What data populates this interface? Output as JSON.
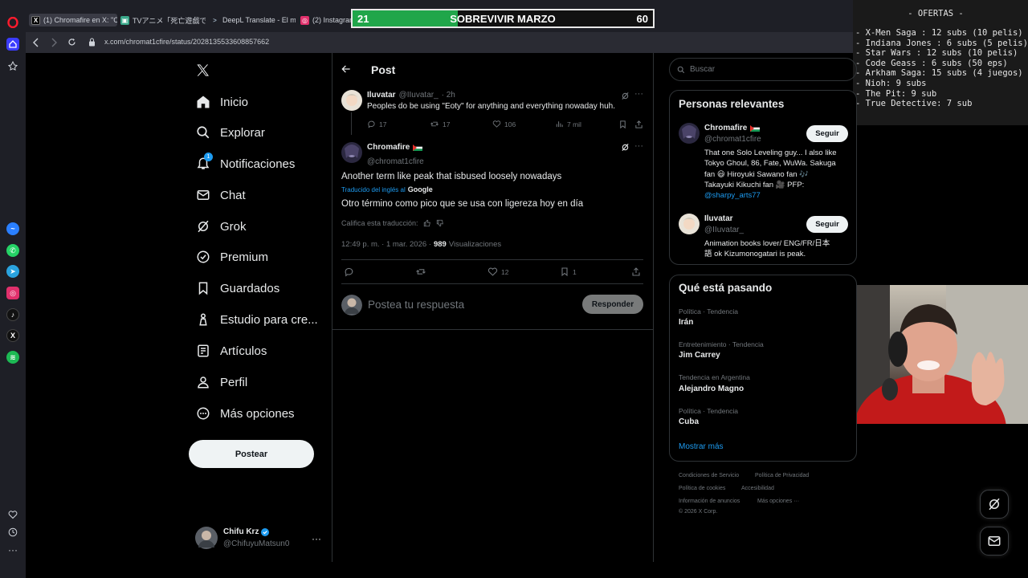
{
  "browser": {
    "tabs": [
      {
        "label": "(1) Chromafire en X: \"C",
        "icon": "x-icon"
      },
      {
        "label": "TVアニメ「死亡遊戯で飯を食",
        "icon": "tv-icon"
      },
      {
        "label": "DeepL Translate - El mejor",
        "icon": "deepl-icon"
      },
      {
        "label": "(2) Instagram",
        "icon": "instagram-icon"
      }
    ],
    "url": "x.com/chromat1cfire/status/2028135533608857662",
    "sidebar_apps": [
      "messenger",
      "whatsapp",
      "telegram",
      "instagram",
      "tiktok",
      "x",
      "spotify"
    ]
  },
  "overlay": {
    "left_count": "21",
    "title": "SOBREVIVIR MARZO",
    "right_count": "60",
    "progress_fraction": 0.35,
    "offers_title": "- OFERTAS -",
    "offers": [
      "- X-Men Saga : 12 subs (10 pelis)",
      "- Indiana Jones : 6 subs (5 pelis)",
      "- Star Wars : 12 subs (10 pelis)",
      "- Code Geass : 6 subs (50 eps)",
      "- Arkham Saga: 15 subs (4 juegos)",
      "- Nioh: 9 subs",
      "- The Pit: 9 sub",
      "- True Detective: 7 sub"
    ]
  },
  "nav": {
    "items": [
      {
        "label": "Inicio",
        "icon": "home-icon"
      },
      {
        "label": "Explorar",
        "icon": "search-icon"
      },
      {
        "label": "Notificaciones",
        "icon": "bell-icon",
        "badge": "1"
      },
      {
        "label": "Chat",
        "icon": "mail-icon"
      },
      {
        "label": "Grok",
        "icon": "grok-icon"
      },
      {
        "label": "Premium",
        "icon": "verified-icon"
      },
      {
        "label": "Guardados",
        "icon": "bookmark-icon"
      },
      {
        "label": "Estudio para cre...",
        "icon": "studio-icon"
      },
      {
        "label": "Artículos",
        "icon": "article-icon"
      },
      {
        "label": "Perfil",
        "icon": "person-icon"
      },
      {
        "label": "Más opciones",
        "icon": "more-circle-icon"
      }
    ],
    "post_button": "Postear",
    "account": {
      "name": "Chifu Krz",
      "handle": "@ChifuyuMatsun0"
    }
  },
  "main": {
    "header": "Post",
    "parent": {
      "name": "Iluvatar",
      "handle": "@IIuvatar_",
      "time": "· 2h",
      "text": "Peoples do be using \"Eoty\" for anything and everything nowaday huh.",
      "replies": "17",
      "reposts": "17",
      "likes": "106",
      "views": "7 mil"
    },
    "post": {
      "name": "Chromafire",
      "handle": "@chromat1cfire",
      "text": "Another term like peak that isbused loosely nowadays",
      "translated_label": "Traducido del inglés al",
      "translator": "Google",
      "translation": "Otro término como pico que se usa con ligereza hoy en día",
      "rate_label": "Califica esta traducción:",
      "timestamp": "12:49 p. m. · 1 mar. 2026 ·",
      "views": "989",
      "views_label": "Visualizaciones",
      "likes": "12",
      "bookmarks": "1"
    },
    "reply_placeholder": "Postea tu respuesta",
    "reply_button": "Responder"
  },
  "right": {
    "search_placeholder": "Buscar",
    "relevant_title": "Personas relevantes",
    "people": [
      {
        "name": "Chromafire",
        "handle": "@chromat1cfire",
        "bio": [
          "That one Solo Leveling guy... I also like",
          "Tokyo Ghoul, 86, Fate, WuWa. Sakuga",
          "fan 😃 Hiroyuki Sawano fan 🎶",
          "Takayuki Kikuchi fan 🎥 PFP:"
        ],
        "link": "@sharpy_arts77",
        "follow": "Seguir"
      },
      {
        "name": "Iluvatar",
        "handle": "@IIuvatar_",
        "bio": [
          "Animation books lover/ ENG/FR/日本",
          "語 ok Kizumonogatari is peak."
        ],
        "follow": "Seguir"
      }
    ],
    "trends_title": "Qué está pasando",
    "trends": [
      {
        "category": "Política · Tendencia",
        "name": "Irán"
      },
      {
        "category": "Entretenimiento · Tendencia",
        "name": "Jim Carrey"
      },
      {
        "category": "Tendencia en Argentina",
        "name": "Alejandro Magno"
      },
      {
        "category": "Política · Tendencia",
        "name": "Cuba"
      }
    ],
    "show_more": "Mostrar más",
    "footer": {
      "terms": "Condiciones de Servicio",
      "privacy": "Política de Privacidad",
      "cookies": "Política de cookies",
      "accessibility": "Accesibilidad",
      "ads": "Información de anuncios",
      "more": "Más opciones ···",
      "copyright": "© 2026 X Corp."
    }
  },
  "colors": {
    "accent": "#1d9bf0",
    "progress": "#20a64a",
    "background": "#000000"
  }
}
